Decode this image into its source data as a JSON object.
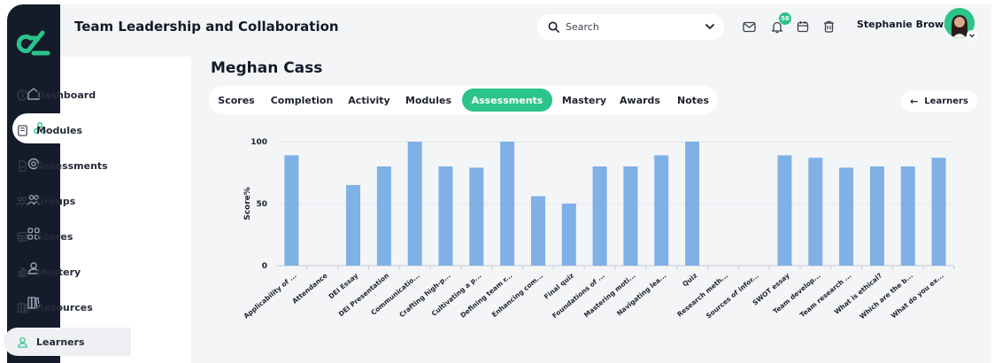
{
  "header": {
    "title": "Team Leadership and Collaboration",
    "search_placeholder": "Search",
    "notification_count": "56",
    "user_name": "Stephanie Brown"
  },
  "sidebar": {
    "items": [
      {
        "label": "Dashboard",
        "icon": "info-circle-icon",
        "active": false
      },
      {
        "label": "Modules",
        "icon": "module-page-icon",
        "active": false
      },
      {
        "label": "Assessments",
        "icon": "assessment-doc-icon",
        "active": false
      },
      {
        "label": "Groups",
        "icon": "groups-icon",
        "active": false
      },
      {
        "label": "Scores",
        "icon": "table-icon",
        "active": false
      },
      {
        "label": "Mastery",
        "icon": "mastery-bars-icon",
        "active": false
      },
      {
        "label": "Resources",
        "icon": "books-icon",
        "active": false
      },
      {
        "label": "Learners",
        "icon": "person-icon",
        "active": true
      }
    ]
  },
  "rail": {
    "items": [
      "home-icon",
      "network-icon",
      "target-icon",
      "people-icon",
      "grid-icon",
      "user-icon",
      "library-icon",
      "analytics-icon"
    ],
    "active_index": 1
  },
  "learner": {
    "name": "Meghan Cass"
  },
  "tabs": [
    {
      "label": "Scores",
      "active": false
    },
    {
      "label": "Completion",
      "active": false
    },
    {
      "label": "Activity",
      "active": false
    },
    {
      "label": "Modules",
      "active": false
    },
    {
      "label": "Assessments",
      "active": true
    },
    {
      "label": "Mastery",
      "active": false
    },
    {
      "label": "Awards",
      "active": false
    },
    {
      "label": "Notes",
      "active": false
    }
  ],
  "back_button": {
    "label": "Learners"
  },
  "colors": {
    "accent": "#2bc48a",
    "bar": "#7fb0e6",
    "rail": "#141b2a"
  },
  "chart_data": {
    "type": "bar",
    "ylabel": "Score%",
    "ylim": [
      0,
      100
    ],
    "yticks": [
      0,
      50,
      100
    ],
    "categories": [
      "Applicability of ...",
      "Attendance",
      "DEI Essay",
      "DEI Presentation",
      "Communicatio...",
      "Crafting high-p...",
      "Cultivating a p...",
      "Defining team r...",
      "Enhancing com...",
      "Final quiz",
      "Foundations of ...",
      "Mastering moti...",
      "Navigating lea...",
      "Quiz",
      "Research meth...",
      "Sources of infor...",
      "SWOT essay",
      "Team develop...",
      "Team research ...",
      "What is ethical?",
      "Which are the b...",
      "What do you ex..."
    ],
    "values": [
      89,
      0,
      65,
      80,
      100,
      80,
      79,
      100,
      56,
      50,
      80,
      80,
      89,
      100,
      0,
      0,
      89,
      87,
      79,
      80,
      80,
      87
    ]
  }
}
